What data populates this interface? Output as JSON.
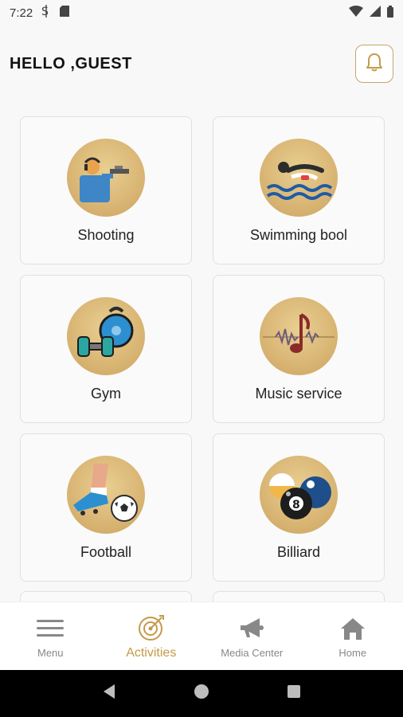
{
  "status_bar": {
    "time": "7:22"
  },
  "header": {
    "greeting": "HELLO ,GUEST"
  },
  "activities": [
    {
      "label": "Shooting",
      "icon": "shooting-icon"
    },
    {
      "label": "Swimming bool",
      "icon": "swimming-icon"
    },
    {
      "label": "Gym",
      "icon": "gym-icon"
    },
    {
      "label": "Music service",
      "icon": "music-icon"
    },
    {
      "label": "Football",
      "icon": "football-icon"
    },
    {
      "label": "Billiard",
      "icon": "billiard-icon"
    }
  ],
  "bottom_nav": [
    {
      "label": "Menu",
      "icon": "menu-icon",
      "active": false
    },
    {
      "label": "Activities",
      "icon": "target-icon",
      "active": true
    },
    {
      "label": "Media Center",
      "icon": "megaphone-icon",
      "active": false
    },
    {
      "label": "Home",
      "icon": "home-icon",
      "active": false
    }
  ],
  "colors": {
    "accent": "#c49a4a",
    "card_circle": "#d9b574",
    "nav_inactive": "#888888"
  }
}
